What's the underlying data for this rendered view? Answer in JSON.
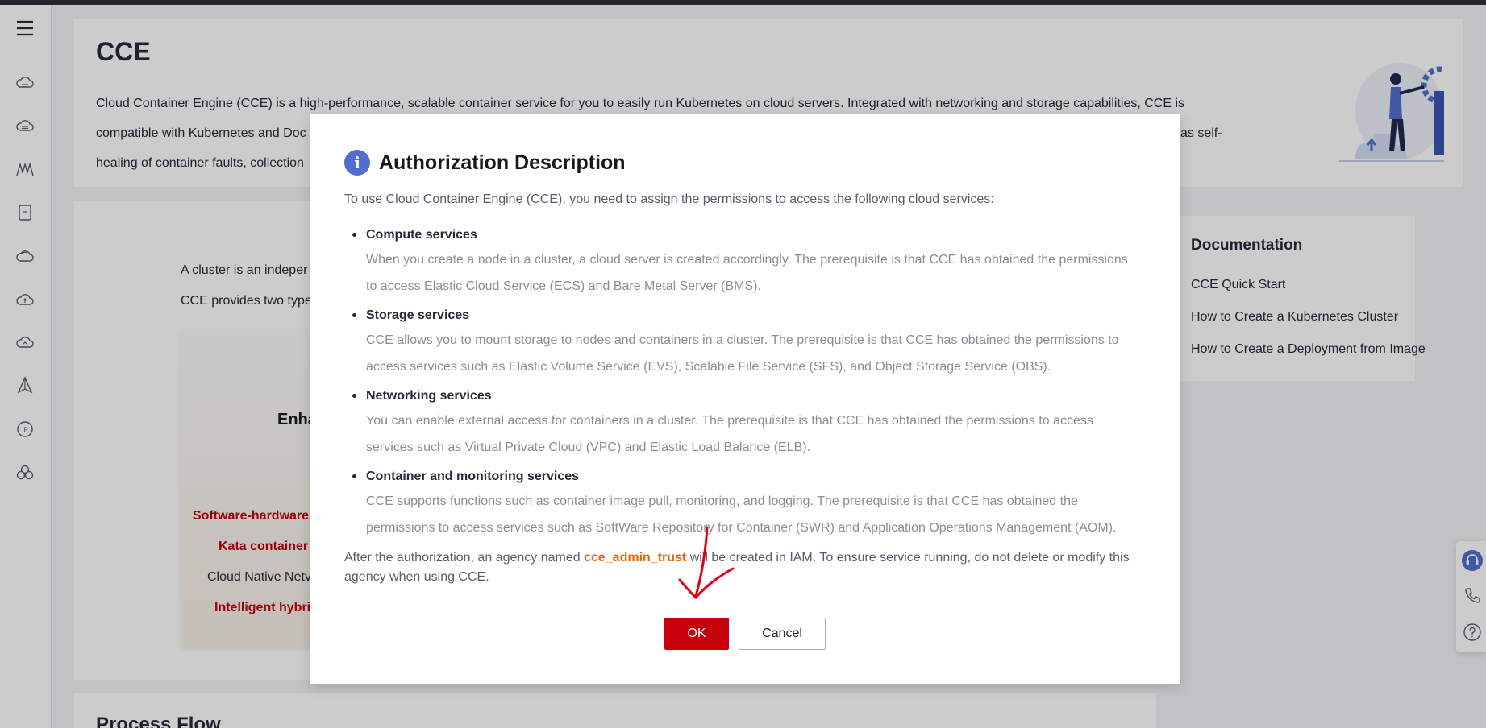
{
  "sidebar": {
    "items": [
      {
        "icon": "hamburger-menu-icon"
      },
      {
        "icon": "cloud-server-icon"
      },
      {
        "icon": "cloud-storage-icon"
      },
      {
        "icon": "container-engine-icon"
      },
      {
        "icon": "database-icon"
      },
      {
        "icon": "cloud-icon"
      },
      {
        "icon": "cloud-upload-icon"
      },
      {
        "icon": "cloud-network-icon"
      },
      {
        "icon": "sail-icon"
      },
      {
        "icon": "ip-icon"
      },
      {
        "icon": "cluster-nodes-icon"
      }
    ]
  },
  "intro": {
    "title": "CCE",
    "line1": "Cloud Container Engine (CCE) is a high-performance, scalable container service for you to easily run Kubernetes on cloud servers. Integrated with networking and storage capabilities, CCE is",
    "line2_start": "compatible with Kubernetes and Doc",
    "line2_end": "as self-",
    "line3_start": "healing of container faults, collection"
  },
  "cluster": {
    "text1": "A cluster is an indeper",
    "text2": "CCE provides two type",
    "feature_title": "Enha",
    "features": [
      {
        "text": "Software-hardware",
        "style": "red"
      },
      {
        "text": "Kata container",
        "style": "red"
      },
      {
        "text": "Cloud Native Netv",
        "style": "dark"
      },
      {
        "text": "Intelligent hybri",
        "style": "red"
      }
    ]
  },
  "documentation": {
    "title": "Documentation",
    "links": [
      "CCE Quick Start",
      "How to Create a Kubernetes Cluster",
      "How to Create a Deployment from Image"
    ]
  },
  "process": {
    "title": "Process Flow"
  },
  "float_toolbar": {
    "items": [
      {
        "icon": "customer-service-icon"
      },
      {
        "icon": "phone-icon"
      },
      {
        "icon": "help-icon"
      }
    ]
  },
  "modal": {
    "icon_glyph": "i",
    "title": "Authorization Description",
    "intro": "To use Cloud Container Engine (CCE), you need to assign the permissions to access the following cloud services:",
    "services": [
      {
        "name": "Compute services",
        "desc_line1": "When you create a node in a cluster, a cloud server is created accordingly. The prerequisite is that CCE has obtained the permissions",
        "desc_line2": "to access Elastic Cloud Service (ECS) and Bare Metal Server (BMS)."
      },
      {
        "name": "Storage services",
        "desc_line1": "CCE allows you to mount storage to nodes and containers in a cluster. The prerequisite is that CCE has obtained the permissions to",
        "desc_line2": "access services such as Elastic Volume Service (EVS), Scalable File Service (SFS), and Object Storage Service (OBS)."
      },
      {
        "name": "Networking services",
        "desc_line1": "You can enable external access for containers in a cluster. The prerequisite is that CCE has obtained the permissions to access",
        "desc_line2": "services such as Virtual Private Cloud (VPC) and Elastic Load Balance (ELB)."
      },
      {
        "name": "Container and monitoring services",
        "desc_line1": "CCE supports functions such as container image pull, monitoring, and logging. The prerequisite is that CCE has obtained the",
        "desc_line2": "permissions to access services such as SoftWare Repository for Container (SWR) and Application Operations Management (AOM)."
      }
    ],
    "note_before": "After the authorization, an agency named ",
    "agency_name": "cce_admin_trust",
    "note_after": " will be created in IAM. To ensure service running, do not delete or modify this agency when using CCE.",
    "ok_label": "OK",
    "cancel_label": "Cancel"
  },
  "colors": {
    "accent_red": "#c7000b",
    "info_blue": "#526ecc",
    "agency_orange": "#e36a00",
    "annotation_red": "#e0001b"
  }
}
